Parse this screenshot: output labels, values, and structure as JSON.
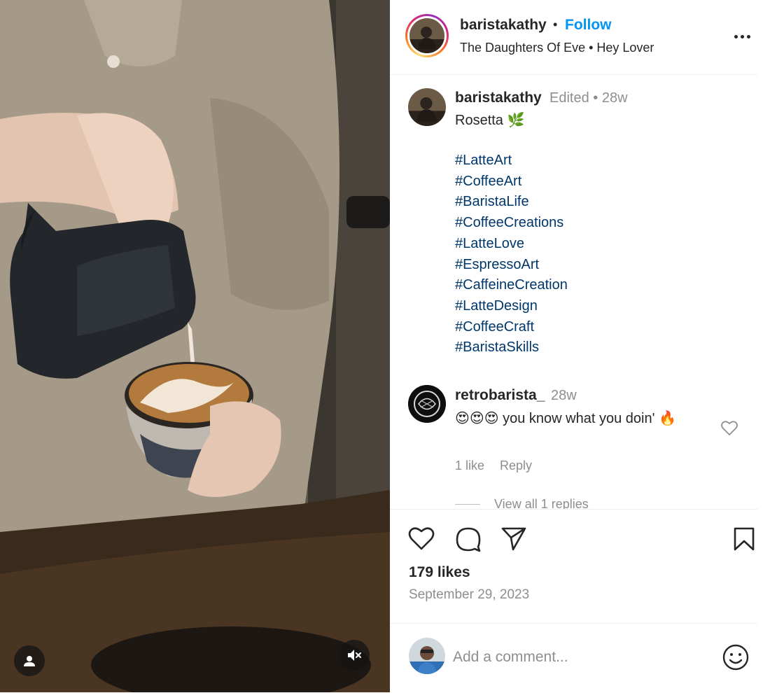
{
  "post": {
    "username": "baristakathy",
    "separator": "•",
    "follow_label": "Follow",
    "audio": "The Daughters Of Eve • Hey Lover",
    "caption": {
      "username": "baristakathy",
      "edited": "Edited •  28w",
      "text": "Rosetta 🌿",
      "hashtags": [
        "#LatteArt",
        "#CoffeeArt",
        "#BaristaLife",
        "#CoffeeCreations",
        "#LatteLove",
        "#EspressoArt",
        "#CaffeineCreation",
        "#LatteDesign",
        "#CoffeeCraft",
        "#BaristaSkills"
      ]
    },
    "comment": {
      "username": "retrobarista_",
      "time": "28w",
      "text": "😍😍😍 you know what you doin' 🔥",
      "likes": "1 like",
      "reply_label": "Reply",
      "view_replies": "View all 1 replies"
    },
    "likes": "179 likes",
    "date": "September 29, 2023",
    "add_comment_placeholder": "Add a comment..."
  },
  "icons": {
    "more": "more-options-icon",
    "like": "heart-icon",
    "comment": "comment-icon",
    "share": "share-icon",
    "save": "bookmark-icon",
    "emoji": "emoji-icon",
    "user_tag": "user-tag-icon",
    "mute": "muted-icon"
  },
  "colors": {
    "follow": "#0095f6",
    "hashtag": "#00376b",
    "muted_text": "#8e8e8e"
  }
}
